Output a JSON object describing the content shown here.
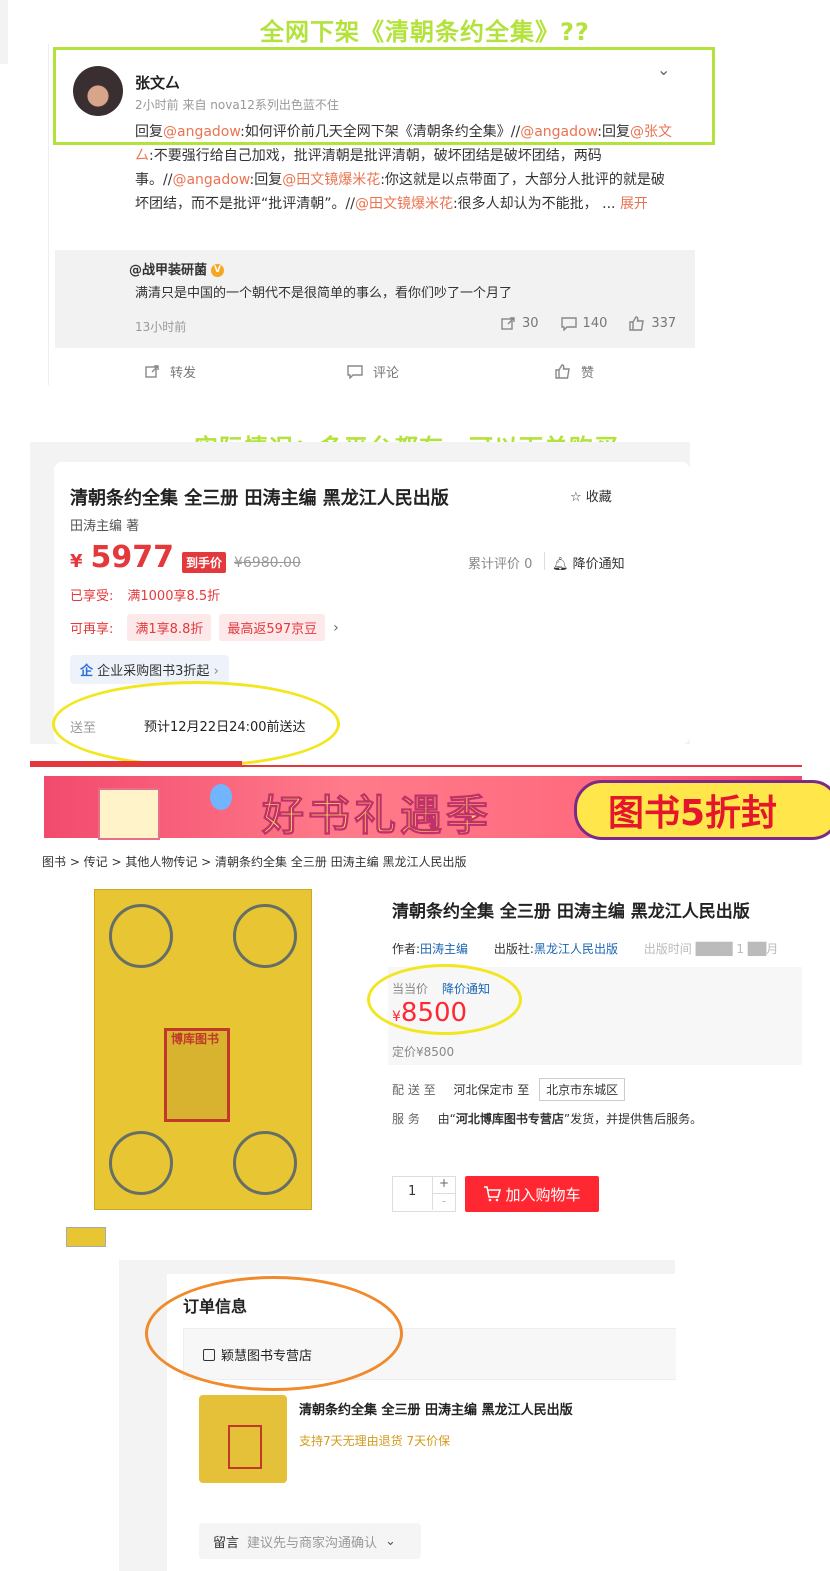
{
  "captions": {
    "top": "全网下架《清朝条约全集》??",
    "middle": "实际情况：多平台都有，可以下单购买"
  },
  "weibo": {
    "username": "张文厶",
    "meta": "2小时前 来自 nova12系列出色蓝不住",
    "body": {
      "t1": "回复",
      "at1": "@angadow",
      "t2": ":如何评价前几天全网下架《清朝条约全集》//",
      "at2": "@angadow",
      "t3": ":回复",
      "at3": "@张文厶",
      "t4": ":不要强行给自己加戏，批评清朝是批评清朝，破坏团结是破坏团结，两码事。//",
      "at4": "@angadow",
      "t5": ":回复",
      "at5": "@田文镜爆米花",
      "t6": ":你这就是以点带面了，大部分人批评的就是破坏团结，而不是批评“批评清朝”。//",
      "at6": "@田文镜爆米花",
      "t7": ":很多人却认为不能批，  ...",
      "expand": "展开"
    },
    "quote": {
      "name": "@战甲装研菌",
      "text": "满清只是中国的一个朝代不是很简单的事么，看你们吵了一个月了",
      "time": "13小时前",
      "reposts": "30",
      "comments": "140",
      "likes": "337"
    },
    "actions": {
      "repost": "转发",
      "comment": "评论",
      "like": "赞"
    }
  },
  "jd": {
    "title": "清朝条约全集 全三册 田涛主编 黑龙江人民出版",
    "favorite": "收藏",
    "author": "田涛主编 著",
    "currency": "¥",
    "price": "5977",
    "price_tag": "到手价",
    "original_price": "¥6980.00",
    "reviews": "累计评价 0",
    "notify": "降价通知",
    "enjoyed_label": "已享受:",
    "enjoyed_value": "满1000享8.5折",
    "more_label": "可再享:",
    "more_chip1": "满1享8.8折",
    "more_chip2": "最高返597京豆",
    "enterprise": "企业采购图书3折起",
    "enterprise_icon": "企",
    "deliver_label": "送至",
    "deliver_text": "预计12月22日24:00前送达"
  },
  "dangdang": {
    "banner_title": "好书礼遇季",
    "banner_pill": "图书5折封",
    "breadcrumb": "图书 > 传记 > 其他人物传记 > 清朝条约全集  全三册  田涛主编  黑龙江人民出版",
    "cover_seal": "博库图书",
    "title": "清朝条约全集 全三册 田涛主编 黑龙江人民出版",
    "author_label": "作者:",
    "author": "田涛主编",
    "publisher_label": "出版社:",
    "publisher": "黑龙江人民出版",
    "blurred": "出版时间 ████ 1 ██月",
    "price_label": "当当价",
    "price_notify": "降价通知",
    "currency": "¥",
    "price": "8500",
    "list_price": "定价¥8500",
    "ship_label": "配 送 至",
    "ship_from": "河北保定市 至",
    "ship_to": "北京市东城区",
    "service_label": "服      务",
    "service_text_1": "由“",
    "service_shop": "河北博库图书专营店",
    "service_text_2": "”发货，并提供售后服务。",
    "qty": "1",
    "qty_plus": "+",
    "qty_minus": "-",
    "cart_button": "加入购物车"
  },
  "order": {
    "title": "订单信息",
    "shop": "颖慧图书专营店",
    "item_title": "清朝条约全集 全三册 田涛主编 黑龙江人民出版",
    "item_sub": "支持7天无理由退货  7天价保",
    "msg_label": "留言",
    "msg_placeholder": "建议先与商家沟通确认"
  },
  "colors": {
    "caption_green": "#b4e23c",
    "weibo_link": "#eb7350",
    "jd_red": "#e4393c",
    "dd_red": "#ff2832",
    "annotation_yellow": "#f2e61e",
    "annotation_orange": "#f08a2a"
  },
  "icons": [
    "chevron-down-icon",
    "repost-icon",
    "comment-icon",
    "like-icon",
    "star-icon",
    "bell-icon",
    "cart-icon",
    "store-icon",
    "verified-badge-icon"
  ]
}
